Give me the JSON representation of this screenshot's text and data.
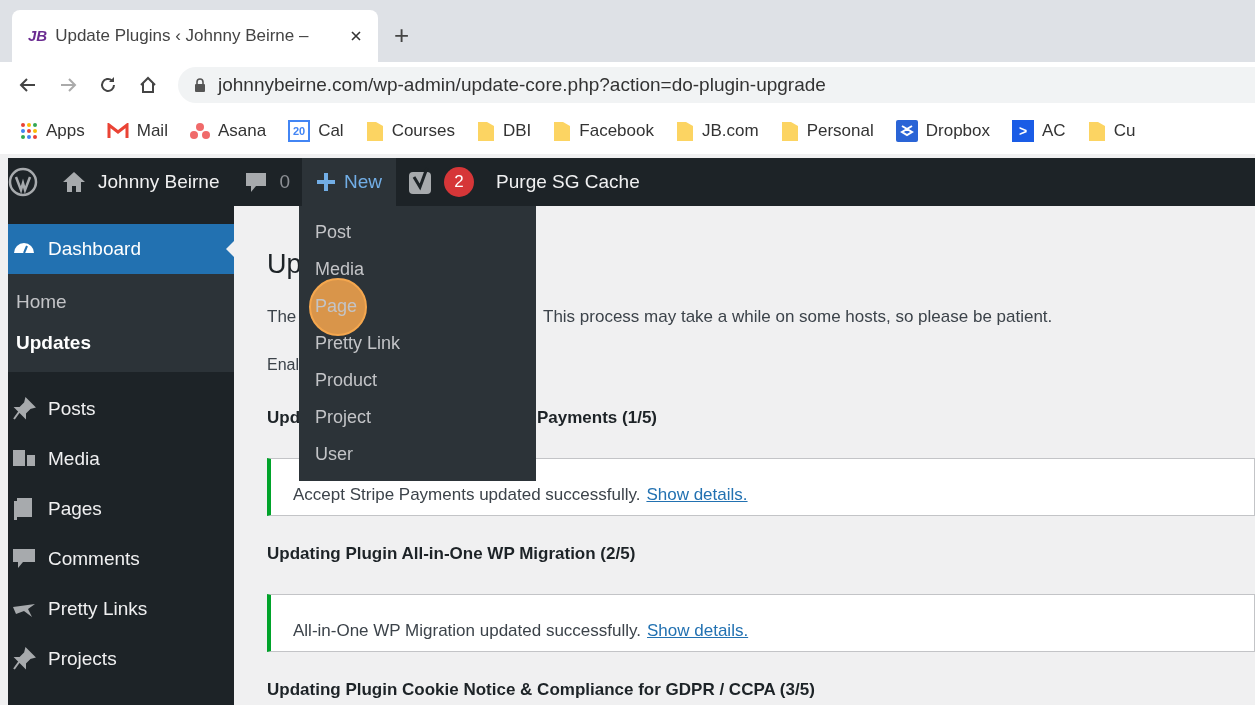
{
  "browser": {
    "tab": {
      "favicon": "JB",
      "title": "Update Plugins ‹ Johnny Beirne –"
    },
    "new_tab": "+",
    "url": "johnnybeirne.com/wp-admin/update-core.php?action=do-plugin-upgrade",
    "bookmarks": [
      {
        "label": "Apps",
        "kind": "apps"
      },
      {
        "label": "Mail",
        "kind": "mail"
      },
      {
        "label": "Asana",
        "kind": "asana"
      },
      {
        "label": "Cal",
        "kind": "calendar",
        "icon_text": "20"
      },
      {
        "label": "Courses",
        "kind": "folder"
      },
      {
        "label": "DBI",
        "kind": "folder"
      },
      {
        "label": "Facebook",
        "kind": "folder"
      },
      {
        "label": "JB.com",
        "kind": "folder"
      },
      {
        "label": "Personal",
        "kind": "folder"
      },
      {
        "label": "Dropbox",
        "kind": "dropbox"
      },
      {
        "label": "AC",
        "kind": "ac",
        "icon_text": ">"
      },
      {
        "label": "Cu",
        "kind": "folder"
      }
    ]
  },
  "admin_bar": {
    "site": "Johnny Beirne",
    "comments": "0",
    "new": {
      "label": "New",
      "expanded": true
    },
    "notifications": "2",
    "purge": "Purge SG Cache",
    "new_menu": [
      {
        "label": "Post",
        "click_marker": false
      },
      {
        "label": "Media",
        "click_marker": false
      },
      {
        "label": "Page",
        "click_marker": true
      },
      {
        "label": "Pretty Link",
        "click_marker": false
      },
      {
        "label": "Product",
        "click_marker": false
      },
      {
        "label": "Project",
        "click_marker": false
      },
      {
        "label": "User",
        "click_marker": false
      }
    ]
  },
  "sidebar": {
    "items": [
      {
        "label": "Dashboard",
        "kind": "dashboard",
        "selected": true,
        "children": [
          {
            "label": "Home",
            "selected": false
          },
          {
            "label": "Updates",
            "selected": true
          }
        ]
      },
      {
        "label": "Posts",
        "kind": "pin",
        "selected": false
      },
      {
        "label": "Media",
        "kind": "media",
        "selected": false
      },
      {
        "label": "Pages",
        "kind": "pages",
        "selected": false
      },
      {
        "label": "Comments",
        "kind": "comment",
        "selected": false
      },
      {
        "label": "Pretty Links",
        "kind": "star",
        "selected": false
      },
      {
        "label": "Projects",
        "kind": "pin",
        "selected": false
      }
    ]
  },
  "content": {
    "heading": "Up",
    "intro_left": "The",
    "intro_right": "This process may take a while on some hosts, so please be patient.",
    "enable_left": "Enal",
    "sections": [
      {
        "heading_left": "Upd",
        "heading_right": "Payments (1/5)",
        "notice": "Accept Stripe Payments updated successfully.",
        "link": "Show details."
      },
      {
        "heading_left": "Updating Plugin All-in-One WP Migration (2/5)",
        "notice": "All-in-One WP Migration updated successfully.",
        "link": "Show details."
      },
      {
        "heading_left": "Updating Plugin Cookie Notice & Compliance for GDPR / CCPA (3/5)"
      }
    ]
  }
}
